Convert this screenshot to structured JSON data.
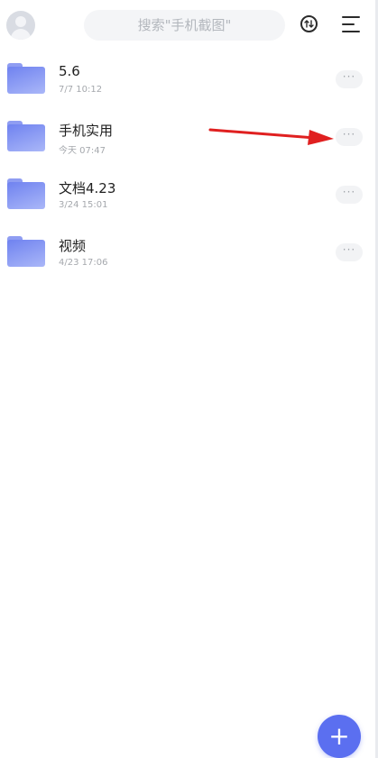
{
  "header": {
    "search_placeholder": "搜索\"手机截图\"",
    "icons": [
      "avatar-icon",
      "sort-icon",
      "menu-icon"
    ]
  },
  "files": [
    {
      "name": "5.6",
      "time": "7/7 10:12"
    },
    {
      "name": "手机实用",
      "time": "今天 07:47"
    },
    {
      "name": "文档4.23",
      "time": "3/24 15:01"
    },
    {
      "name": "视频",
      "time": "4/23 17:06"
    }
  ],
  "more_label": "···",
  "fab_label": "+",
  "colors": {
    "accent": "#5b6ff0",
    "folder": "#7f91f3",
    "arrow": "#e02020"
  }
}
